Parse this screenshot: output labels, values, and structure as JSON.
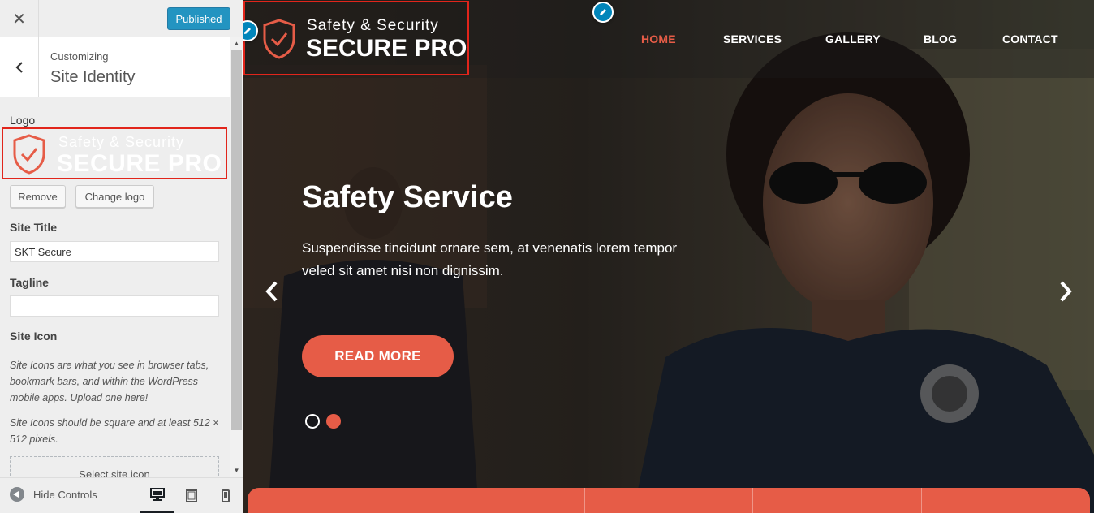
{
  "customizer": {
    "close_label": "✕",
    "publish_label": "Published",
    "customizing_label": "Customizing",
    "section_title": "Site Identity",
    "logo": {
      "label": "Logo",
      "line1": "Safety & Security",
      "line2": "SECURE PRO",
      "remove_label": "Remove",
      "change_label": "Change logo"
    },
    "site_title": {
      "label": "Site Title",
      "value": "SKT Secure"
    },
    "tagline": {
      "label": "Tagline",
      "value": ""
    },
    "site_icon": {
      "label": "Site Icon",
      "description1": "Site Icons are what you see in browser tabs, bookmark bars, and within the WordPress mobile apps. Upload one here!",
      "description2": "Site Icons should be square and at least 512 × 512 pixels.",
      "select_label": "Select site icon"
    },
    "footer": {
      "hide_controls_label": "Hide Controls",
      "devices": [
        "desktop-icon",
        "tablet-icon",
        "mobile-icon"
      ],
      "active_device": "desktop"
    }
  },
  "preview": {
    "logo": {
      "line1": "Safety & Security",
      "line2": "SECURE PRO"
    },
    "nav": {
      "home": "HOME",
      "services": "SERVICES",
      "gallery": "GALLERY",
      "blog": "BLOG",
      "contact": "CONTACT",
      "active": "HOME"
    },
    "slide": {
      "title": "Safety Service",
      "text": "Suspendisse tincidunt ornare sem, at venenatis lorem tempor veled sit amet nisi non dignissim.",
      "button_label": "READ MORE",
      "active_dot": 2,
      "dot_count": 2
    }
  },
  "colors": {
    "accent": "#e65c47",
    "wp_blue": "#0085ba",
    "highlight_border": "#e1251b",
    "sidebar_bg": "#eeeeee"
  }
}
